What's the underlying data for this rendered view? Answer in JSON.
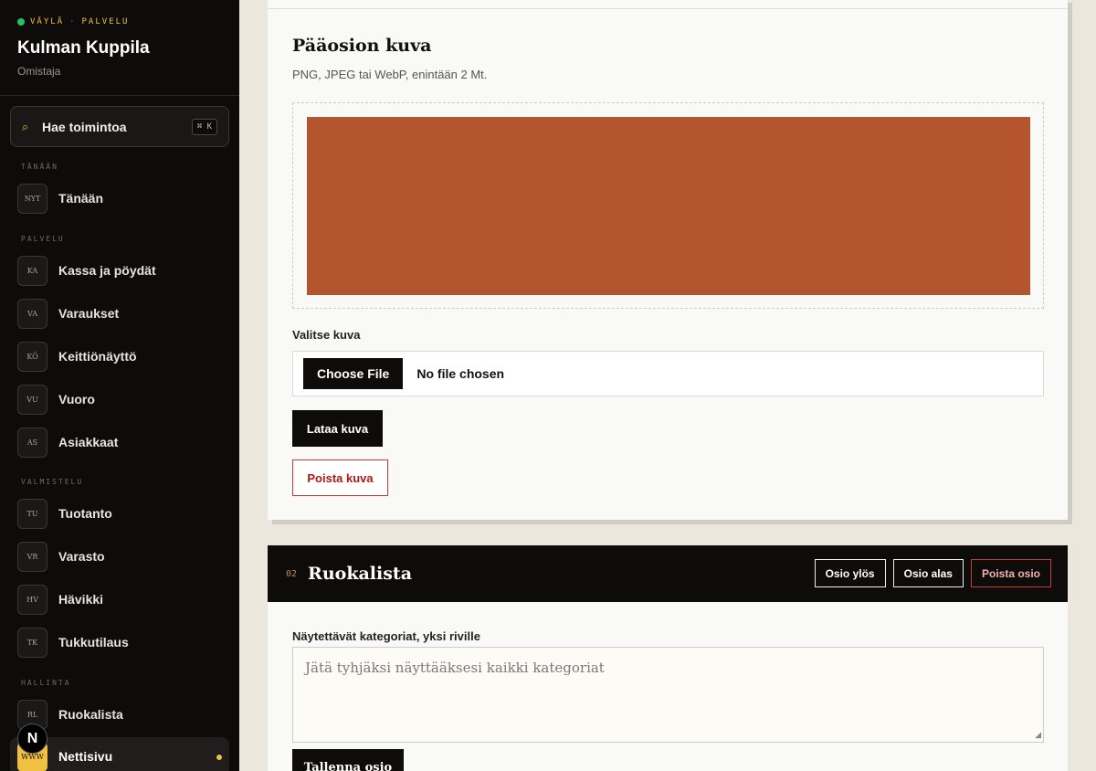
{
  "sidebar": {
    "brand_tag_left": "VÄYLÄ",
    "brand_tag_sep": "·",
    "brand_tag_right": "PALVELU",
    "brand_name": "Kulman Kuppila",
    "brand_role": "Omistaja",
    "search_label": "Hae toimintoa",
    "search_shortcut": "⌘ K",
    "search_icon": "search-icon",
    "sections": [
      {
        "label": "TÄNÄÄN"
      },
      {
        "label": "PALVELU"
      },
      {
        "label": "VALMISTELU"
      },
      {
        "label": "HALLINTA"
      }
    ],
    "items": [
      {
        "code": "NYT",
        "label": "Tänään"
      },
      {
        "code": "KA",
        "label": "Kassa ja pöydät"
      },
      {
        "code": "VA",
        "label": "Varaukset"
      },
      {
        "code": "KÖ",
        "label": "Keittiönäyttö"
      },
      {
        "code": "VU",
        "label": "Vuoro"
      },
      {
        "code": "AS",
        "label": "Asiakkaat"
      },
      {
        "code": "TU",
        "label": "Tuotanto"
      },
      {
        "code": "VR",
        "label": "Varasto"
      },
      {
        "code": "HV",
        "label": "Hävikki"
      },
      {
        "code": "TK",
        "label": "Tukkutilaus"
      },
      {
        "code": "RL",
        "label": "Ruokalista"
      },
      {
        "code": "WWW",
        "label": "Nettisivu"
      }
    ],
    "active_item": "Nettisivu",
    "logo_letter": "N"
  },
  "image_section": {
    "title": "Pääosion kuva",
    "hint": "PNG, JPEG tai WebP, enintään 2 Mt.",
    "preview_color": "#b55530",
    "file_label": "Valitse kuva",
    "file_button": "Choose File",
    "file_status": "No file chosen",
    "upload_button": "Lataa kuva",
    "delete_button": "Poista kuva"
  },
  "menu_section": {
    "number": "02",
    "title": "Ruokalista",
    "move_up": "Osio ylös",
    "move_down": "Osio alas",
    "delete": "Poista osio",
    "categories_label": "Näytettävät kategoriat, yksi riville",
    "categories_placeholder": "Jätä tyhjäksi näyttääksesi kaikki kategoriat",
    "categories_value": "",
    "save_button": "Tallenna osio"
  },
  "colors": {
    "sidebar_bg": "#0d0c0b",
    "accent": "#f0c040",
    "status_green": "#22c55e",
    "danger": "#b01818",
    "page_bg": "#ebe7dc"
  }
}
